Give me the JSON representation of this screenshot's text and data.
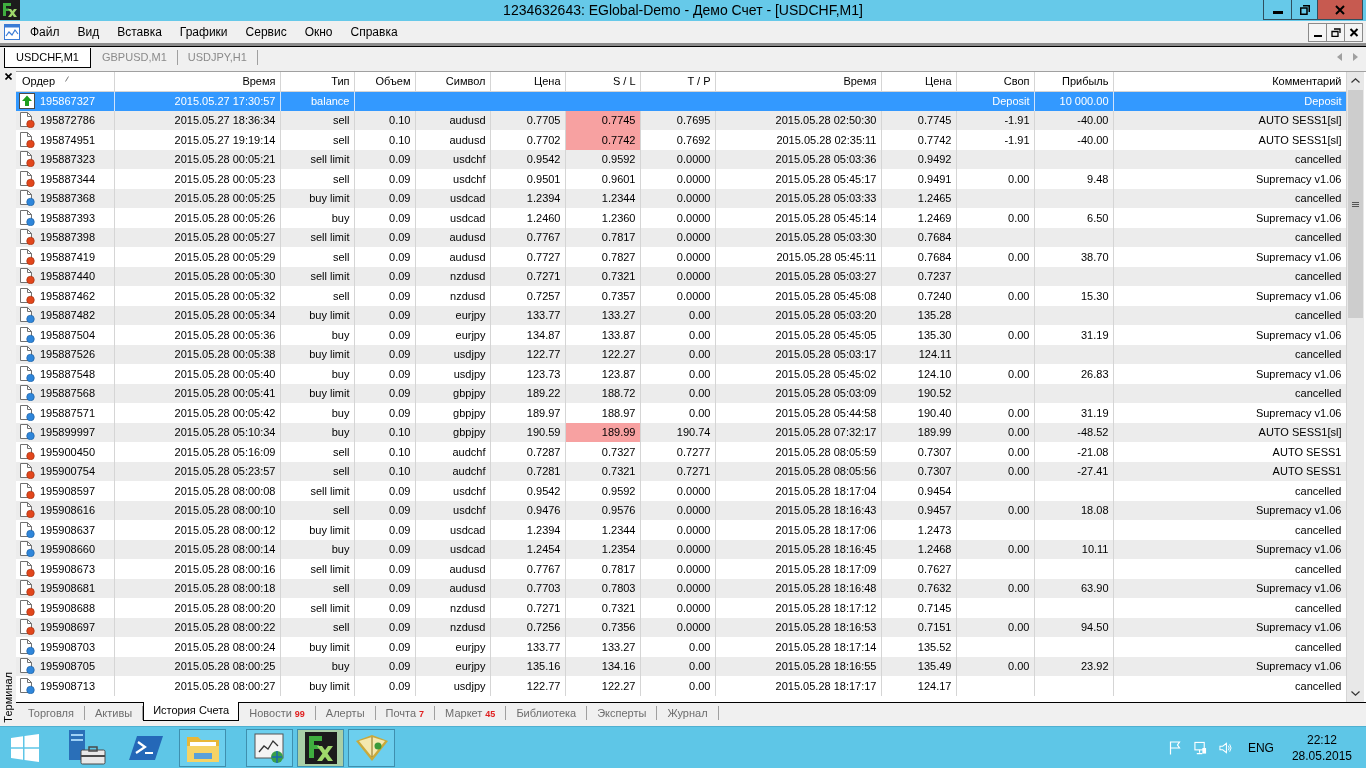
{
  "window": {
    "title": "1234632643: EGlobal-Demo - Демо Счет - [USDCHF,M1]"
  },
  "menu": [
    "Файл",
    "Вид",
    "Вставка",
    "Графики",
    "Сервис",
    "Окно",
    "Справка"
  ],
  "chart_tabs": [
    {
      "label": "USDCHF,M1",
      "selected": true
    },
    {
      "label": "GBPUSD,M1",
      "selected": false
    },
    {
      "label": "USDJPY,H1",
      "selected": false
    }
  ],
  "terminal": {
    "label": "Терминал",
    "table": {
      "columns": [
        {
          "label": "Ордер",
          "sorted": true
        },
        {
          "label": "Время",
          "sorted": false
        },
        {
          "label": "Тип",
          "sorted": false
        },
        {
          "label": "Объем",
          "sorted": false
        },
        {
          "label": "Символ",
          "sorted": false
        },
        {
          "label": "Цена",
          "sorted": false
        },
        {
          "label": "S / L",
          "sorted": false
        },
        {
          "label": "T / P",
          "sorted": false
        },
        {
          "label": "Время",
          "sorted": false
        },
        {
          "label": "Цена",
          "sorted": false
        },
        {
          "label": "Своп",
          "sorted": false
        },
        {
          "label": "Прибыль",
          "sorted": false
        },
        {
          "label": "Комментарий",
          "sorted": false
        }
      ],
      "rows": [
        {
          "kind": "balance",
          "selected": true,
          "sl_highlight": false,
          "cells": [
            "195867327",
            "2015.05.27 17:30:57",
            "balance",
            null,
            null,
            null,
            null,
            null,
            null,
            null,
            "Deposit",
            "10 000.00",
            "Deposit"
          ]
        },
        {
          "kind": "sell",
          "selected": false,
          "sl_highlight": true,
          "cells": [
            "195872786",
            "2015.05.27 18:36:34",
            "sell",
            "0.10",
            "audusd",
            "0.7705",
            "0.7745",
            "0.7695",
            "2015.05.28 02:50:30",
            "0.7745",
            "-1.91",
            "-40.00",
            "AUTO SESS1[sl]"
          ]
        },
        {
          "kind": "sell",
          "selected": false,
          "sl_highlight": true,
          "cells": [
            "195874951",
            "2015.05.27 19:19:14",
            "sell",
            "0.10",
            "audusd",
            "0.7702",
            "0.7742",
            "0.7692",
            "2015.05.28 02:35:11",
            "0.7742",
            "-1.91",
            "-40.00",
            "AUTO SESS1[sl]"
          ]
        },
        {
          "kind": "sell",
          "selected": false,
          "sl_highlight": false,
          "cells": [
            "195887323",
            "2015.05.28 00:05:21",
            "sell limit",
            "0.09",
            "usdchf",
            "0.9542",
            "0.9592",
            "0.0000",
            "2015.05.28 05:03:36",
            "0.9492",
            null,
            null,
            "cancelled"
          ]
        },
        {
          "kind": "sell",
          "selected": false,
          "sl_highlight": false,
          "cells": [
            "195887344",
            "2015.05.28 00:05:23",
            "sell",
            "0.09",
            "usdchf",
            "0.9501",
            "0.9601",
            "0.0000",
            "2015.05.28 05:45:17",
            "0.9491",
            "0.00",
            "9.48",
            "Supremacy v1.06"
          ]
        },
        {
          "kind": "buy",
          "selected": false,
          "sl_highlight": false,
          "cells": [
            "195887368",
            "2015.05.28 00:05:25",
            "buy limit",
            "0.09",
            "usdcad",
            "1.2394",
            "1.2344",
            "0.0000",
            "2015.05.28 05:03:33",
            "1.2465",
            null,
            null,
            "cancelled"
          ]
        },
        {
          "kind": "buy",
          "selected": false,
          "sl_highlight": false,
          "cells": [
            "195887393",
            "2015.05.28 00:05:26",
            "buy",
            "0.09",
            "usdcad",
            "1.2460",
            "1.2360",
            "0.0000",
            "2015.05.28 05:45:14",
            "1.2469",
            "0.00",
            "6.50",
            "Supremacy v1.06"
          ]
        },
        {
          "kind": "sell",
          "selected": false,
          "sl_highlight": false,
          "cells": [
            "195887398",
            "2015.05.28 00:05:27",
            "sell limit",
            "0.09",
            "audusd",
            "0.7767",
            "0.7817",
            "0.0000",
            "2015.05.28 05:03:30",
            "0.7684",
            null,
            null,
            "cancelled"
          ]
        },
        {
          "kind": "sell",
          "selected": false,
          "sl_highlight": false,
          "cells": [
            "195887419",
            "2015.05.28 00:05:29",
            "sell",
            "0.09",
            "audusd",
            "0.7727",
            "0.7827",
            "0.0000",
            "2015.05.28 05:45:11",
            "0.7684",
            "0.00",
            "38.70",
            "Supremacy v1.06"
          ]
        },
        {
          "kind": "sell",
          "selected": false,
          "sl_highlight": false,
          "cells": [
            "195887440",
            "2015.05.28 00:05:30",
            "sell limit",
            "0.09",
            "nzdusd",
            "0.7271",
            "0.7321",
            "0.0000",
            "2015.05.28 05:03:27",
            "0.7237",
            null,
            null,
            "cancelled"
          ]
        },
        {
          "kind": "sell",
          "selected": false,
          "sl_highlight": false,
          "cells": [
            "195887462",
            "2015.05.28 00:05:32",
            "sell",
            "0.09",
            "nzdusd",
            "0.7257",
            "0.7357",
            "0.0000",
            "2015.05.28 05:45:08",
            "0.7240",
            "0.00",
            "15.30",
            "Supremacy v1.06"
          ]
        },
        {
          "kind": "buy",
          "selected": false,
          "sl_highlight": false,
          "cells": [
            "195887482",
            "2015.05.28 00:05:34",
            "buy limit",
            "0.09",
            "eurjpy",
            "133.77",
            "133.27",
            "0.00",
            "2015.05.28 05:03:20",
            "135.28",
            null,
            null,
            "cancelled"
          ]
        },
        {
          "kind": "buy",
          "selected": false,
          "sl_highlight": false,
          "cells": [
            "195887504",
            "2015.05.28 00:05:36",
            "buy",
            "0.09",
            "eurjpy",
            "134.87",
            "133.87",
            "0.00",
            "2015.05.28 05:45:05",
            "135.30",
            "0.00",
            "31.19",
            "Supremacy v1.06"
          ]
        },
        {
          "kind": "buy",
          "selected": false,
          "sl_highlight": false,
          "cells": [
            "195887526",
            "2015.05.28 00:05:38",
            "buy limit",
            "0.09",
            "usdjpy",
            "122.77",
            "122.27",
            "0.00",
            "2015.05.28 05:03:17",
            "124.11",
            null,
            null,
            "cancelled"
          ]
        },
        {
          "kind": "buy",
          "selected": false,
          "sl_highlight": false,
          "cells": [
            "195887548",
            "2015.05.28 00:05:40",
            "buy",
            "0.09",
            "usdjpy",
            "123.73",
            "123.87",
            "0.00",
            "2015.05.28 05:45:02",
            "124.10",
            "0.00",
            "26.83",
            "Supremacy v1.06"
          ]
        },
        {
          "kind": "buy",
          "selected": false,
          "sl_highlight": false,
          "cells": [
            "195887568",
            "2015.05.28 00:05:41",
            "buy limit",
            "0.09",
            "gbpjpy",
            "189.22",
            "188.72",
            "0.00",
            "2015.05.28 05:03:09",
            "190.52",
            null,
            null,
            "cancelled"
          ]
        },
        {
          "kind": "buy",
          "selected": false,
          "sl_highlight": false,
          "cells": [
            "195887571",
            "2015.05.28 00:05:42",
            "buy",
            "0.09",
            "gbpjpy",
            "189.97",
            "188.97",
            "0.00",
            "2015.05.28 05:44:58",
            "190.40",
            "0.00",
            "31.19",
            "Supremacy v1.06"
          ]
        },
        {
          "kind": "buy",
          "selected": false,
          "sl_highlight": true,
          "cells": [
            "195899997",
            "2015.05.28 05:10:34",
            "buy",
            "0.10",
            "gbpjpy",
            "190.59",
            "189.99",
            "190.74",
            "2015.05.28 07:32:17",
            "189.99",
            "0.00",
            "-48.52",
            "AUTO SESS1[sl]"
          ]
        },
        {
          "kind": "sell",
          "selected": false,
          "sl_highlight": false,
          "cells": [
            "195900450",
            "2015.05.28 05:16:09",
            "sell",
            "0.10",
            "audchf",
            "0.7287",
            "0.7327",
            "0.7277",
            "2015.05.28 08:05:59",
            "0.7307",
            "0.00",
            "-21.08",
            "AUTO SESS1"
          ]
        },
        {
          "kind": "sell",
          "selected": false,
          "sl_highlight": false,
          "cells": [
            "195900754",
            "2015.05.28 05:23:57",
            "sell",
            "0.10",
            "audchf",
            "0.7281",
            "0.7321",
            "0.7271",
            "2015.05.28 08:05:56",
            "0.7307",
            "0.00",
            "-27.41",
            "AUTO SESS1"
          ]
        },
        {
          "kind": "sell",
          "selected": false,
          "sl_highlight": false,
          "cells": [
            "195908597",
            "2015.05.28 08:00:08",
            "sell limit",
            "0.09",
            "usdchf",
            "0.9542",
            "0.9592",
            "0.0000",
            "2015.05.28 18:17:04",
            "0.9454",
            null,
            null,
            "cancelled"
          ]
        },
        {
          "kind": "sell",
          "selected": false,
          "sl_highlight": false,
          "cells": [
            "195908616",
            "2015.05.28 08:00:10",
            "sell",
            "0.09",
            "usdchf",
            "0.9476",
            "0.9576",
            "0.0000",
            "2015.05.28 18:16:43",
            "0.9457",
            "0.00",
            "18.08",
            "Supremacy v1.06"
          ]
        },
        {
          "kind": "buy",
          "selected": false,
          "sl_highlight": false,
          "cells": [
            "195908637",
            "2015.05.28 08:00:12",
            "buy limit",
            "0.09",
            "usdcad",
            "1.2394",
            "1.2344",
            "0.0000",
            "2015.05.28 18:17:06",
            "1.2473",
            null,
            null,
            "cancelled"
          ]
        },
        {
          "kind": "buy",
          "selected": false,
          "sl_highlight": false,
          "cells": [
            "195908660",
            "2015.05.28 08:00:14",
            "buy",
            "0.09",
            "usdcad",
            "1.2454",
            "1.2354",
            "0.0000",
            "2015.05.28 18:16:45",
            "1.2468",
            "0.00",
            "10.11",
            "Supremacy v1.06"
          ]
        },
        {
          "kind": "sell",
          "selected": false,
          "sl_highlight": false,
          "cells": [
            "195908673",
            "2015.05.28 08:00:16",
            "sell limit",
            "0.09",
            "audusd",
            "0.7767",
            "0.7817",
            "0.0000",
            "2015.05.28 18:17:09",
            "0.7627",
            null,
            null,
            "cancelled"
          ]
        },
        {
          "kind": "sell",
          "selected": false,
          "sl_highlight": false,
          "cells": [
            "195908681",
            "2015.05.28 08:00:18",
            "sell",
            "0.09",
            "audusd",
            "0.7703",
            "0.7803",
            "0.0000",
            "2015.05.28 18:16:48",
            "0.7632",
            "0.00",
            "63.90",
            "Supremacy v1.06"
          ]
        },
        {
          "kind": "sell",
          "selected": false,
          "sl_highlight": false,
          "cells": [
            "195908688",
            "2015.05.28 08:00:20",
            "sell limit",
            "0.09",
            "nzdusd",
            "0.7271",
            "0.7321",
            "0.0000",
            "2015.05.28 18:17:12",
            "0.7145",
            null,
            null,
            "cancelled"
          ]
        },
        {
          "kind": "sell",
          "selected": false,
          "sl_highlight": false,
          "cells": [
            "195908697",
            "2015.05.28 08:00:22",
            "sell",
            "0.09",
            "nzdusd",
            "0.7256",
            "0.7356",
            "0.0000",
            "2015.05.28 18:16:53",
            "0.7151",
            "0.00",
            "94.50",
            "Supremacy v1.06"
          ]
        },
        {
          "kind": "buy",
          "selected": false,
          "sl_highlight": false,
          "cells": [
            "195908703",
            "2015.05.28 08:00:24",
            "buy limit",
            "0.09",
            "eurjpy",
            "133.77",
            "133.27",
            "0.00",
            "2015.05.28 18:17:14",
            "135.52",
            null,
            null,
            "cancelled"
          ]
        },
        {
          "kind": "buy",
          "selected": false,
          "sl_highlight": false,
          "cells": [
            "195908705",
            "2015.05.28 08:00:25",
            "buy",
            "0.09",
            "eurjpy",
            "135.16",
            "134.16",
            "0.00",
            "2015.05.28 18:16:55",
            "135.49",
            "0.00",
            "23.92",
            "Supremacy v1.06"
          ]
        },
        {
          "kind": "buy",
          "selected": false,
          "sl_highlight": false,
          "cells": [
            "195908713",
            "2015.05.28 08:00:27",
            "buy limit",
            "0.09",
            "usdjpy",
            "122.77",
            "122.27",
            "0.00",
            "2015.05.28 18:17:17",
            "124.17",
            null,
            null,
            "cancelled"
          ]
        }
      ]
    },
    "tabs": [
      {
        "label": "Торговля",
        "selected": false
      },
      {
        "label": "Активы",
        "selected": false
      },
      {
        "label": "История Счета",
        "selected": true
      },
      {
        "label": "Новости",
        "count": "99",
        "selected": false
      },
      {
        "label": "Алерты",
        "selected": false
      },
      {
        "label": "Почта",
        "count": "7",
        "selected": false
      },
      {
        "label": "Маркет",
        "count": "45",
        "selected": false
      },
      {
        "label": "Библиотека",
        "selected": false
      },
      {
        "label": "Эксперты",
        "selected": false
      },
      {
        "label": "Журнал",
        "selected": false
      }
    ]
  },
  "taskbar": {
    "language": "ENG",
    "time": "22:12",
    "date": "28.05.2015"
  }
}
